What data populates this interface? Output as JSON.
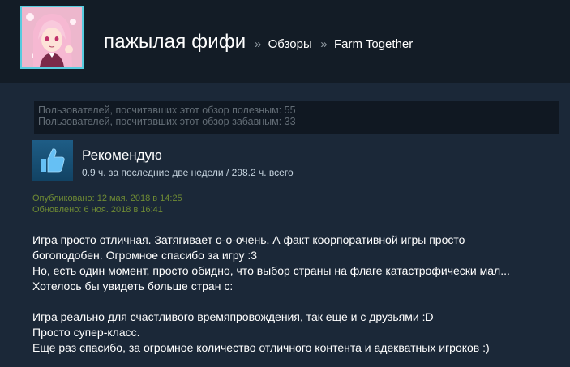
{
  "profile": {
    "name": "пажылая фифи",
    "breadcrumb_sep_1": "»",
    "breadcrumb_reviews": "Обзоры",
    "breadcrumb_sep_2": "»",
    "breadcrumb_game": "Farm Together"
  },
  "votes": {
    "helpful": "Пользователей, посчитавших этот обзор полезным: 55",
    "funny": "Пользователей, посчитавших этот обзор забавным: 33"
  },
  "review": {
    "thumb_icon": "thumbs-up-icon",
    "verdict": "Рекомендую",
    "hours": "0.9 ч. за последние две недели / 298.2 ч. всего",
    "posted": "Опубликовано: 12 мая. 2018 в 14:25",
    "updated": "Обновлено: 6 ноя. 2018 в 16:41",
    "lines": [
      "Игра просто отличная. Затягивает о-о-очень. А факт коорпоративной игры просто",
      "богоподобен. Огромное спасибо за игру :3",
      "Но, есть один момент, просто обидно, что выбор страны на флаге катастрофически мал...",
      "Хотелось бы увидеть больше стран с:",
      "",
      "Игра реально для счастливого времяпровождения, так еще и с друзьями :D",
      "Просто супер-класс.",
      "Еще раз спасибо, за огромное количество отличного контента и адекватных игроков :)"
    ]
  },
  "colors": {
    "background": "#1b2838",
    "header": "#131c26",
    "avatar_border": "#57cbde",
    "thumb_blue": "#1e5d86",
    "date_green": "#6f8b34"
  }
}
